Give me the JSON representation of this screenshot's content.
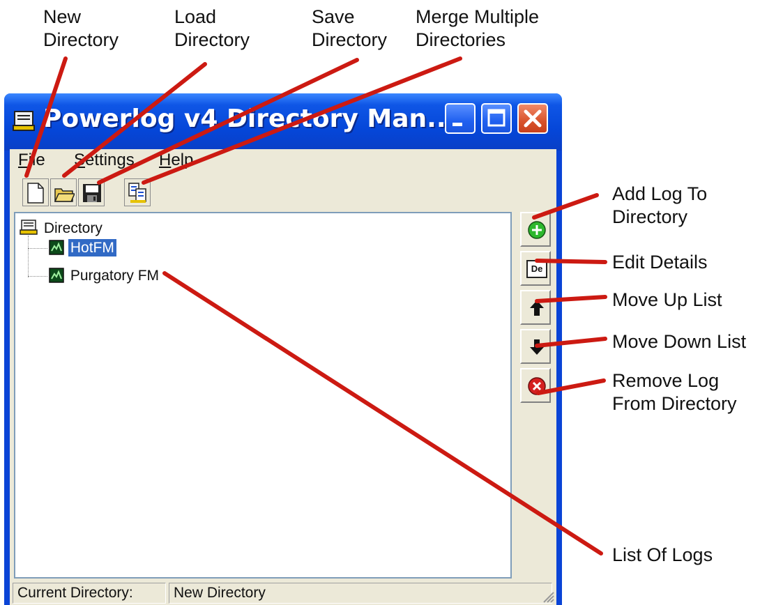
{
  "callouts": {
    "new_directory": [
      "New",
      "Directory"
    ],
    "load_directory": [
      "Load",
      "Directory"
    ],
    "save_directory": [
      "Save",
      "Directory"
    ],
    "merge_directories": [
      "Merge Multiple",
      "Directories"
    ],
    "add_log": [
      "Add Log To",
      "Directory"
    ],
    "edit_details": "Edit Details",
    "move_up": "Move Up List",
    "move_down": "Move Down List",
    "remove_log": [
      "Remove Log",
      "From Directory"
    ],
    "list_of_logs": "List Of Logs"
  },
  "window": {
    "title": "Powerlog v4 Directory Man..."
  },
  "menu": {
    "file": {
      "accel": "F",
      "rest": "ile"
    },
    "settings": {
      "accel": "S",
      "rest": "ettings"
    },
    "help": {
      "accel": "H",
      "rest": "elp"
    }
  },
  "tree": {
    "root": "Directory",
    "items": [
      {
        "label": "HotFM",
        "selected": true
      },
      {
        "label": "Purgatory FM",
        "selected": false
      }
    ]
  },
  "side_buttons": {
    "edit_details_glyph": "De"
  },
  "status": {
    "label": "Current Directory:",
    "value": "New Directory"
  },
  "colors": {
    "leader": "#cc1a12",
    "titlebar": "#0546d8",
    "selection": "#316ac5"
  },
  "icons": [
    "new-file-icon",
    "open-folder-icon",
    "floppy-disk-icon",
    "merge-icon",
    "add-icon",
    "details-icon",
    "arrow-up-icon",
    "arrow-down-icon",
    "remove-icon"
  ]
}
